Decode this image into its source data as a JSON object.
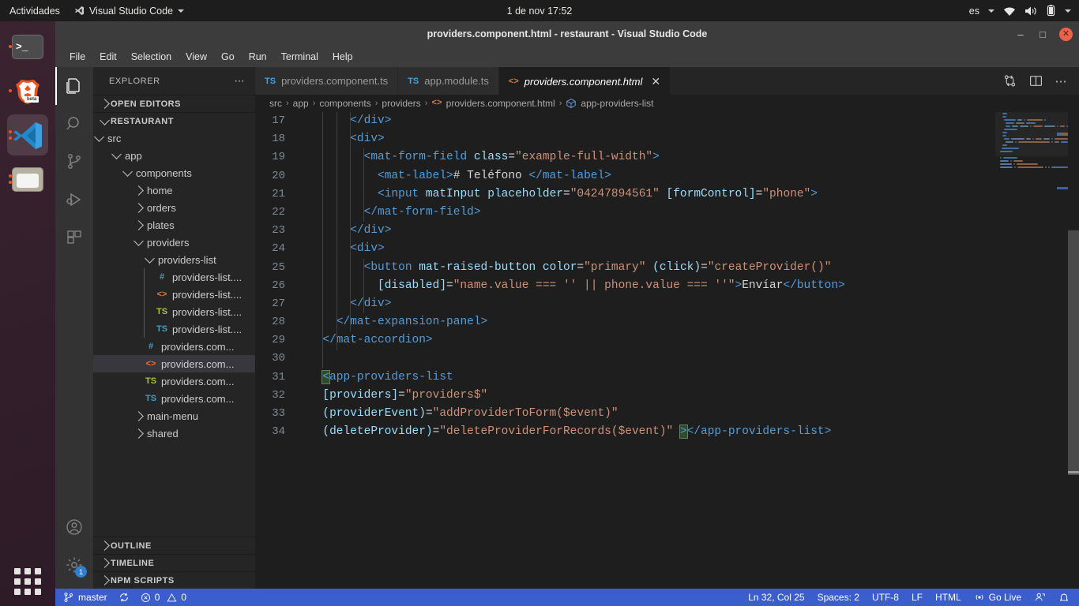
{
  "gnome": {
    "activities": "Actividades",
    "app_menu": "Visual Studio Code",
    "app_icon": "vscode-icon",
    "clock": "1 de nov  17:52",
    "keyboard_layout": "es",
    "icons": [
      "wifi-icon",
      "volume-icon",
      "battery-icon",
      "chevron-down-icon"
    ]
  },
  "dock": {
    "items": [
      {
        "name": "terminal",
        "label": "Terminal",
        "running": true,
        "active": false
      },
      {
        "name": "brave-beta",
        "label": "Brave Beta",
        "badge": "beta",
        "running": true,
        "active": false
      },
      {
        "name": "vscode",
        "label": "Visual Studio Code",
        "running": true,
        "active": true
      },
      {
        "name": "files",
        "label": "Files",
        "running": true,
        "active": false
      }
    ],
    "show_apps_label": "Mostrar aplicaciones"
  },
  "window": {
    "title": "providers.component.html - restaurant - Visual Studio Code",
    "minimize": "–",
    "maximize": "□",
    "close": "✕"
  },
  "menubar": {
    "items": [
      "File",
      "Edit",
      "Selection",
      "View",
      "Go",
      "Run",
      "Terminal",
      "Help"
    ]
  },
  "activitybar": {
    "items": [
      {
        "name": "explorer",
        "icon": "files-icon",
        "active": true
      },
      {
        "name": "search",
        "icon": "search-icon",
        "active": false
      },
      {
        "name": "source-control",
        "icon": "source-control-icon",
        "active": false
      },
      {
        "name": "run-debug",
        "icon": "run-and-debug-icon",
        "active": false
      },
      {
        "name": "extensions",
        "icon": "extensions-icon",
        "active": false
      }
    ],
    "bottom": [
      {
        "name": "accounts",
        "icon": "account-icon",
        "badge": ""
      },
      {
        "name": "manage",
        "icon": "gear-icon",
        "badge": "1"
      }
    ]
  },
  "sidebar": {
    "title": "EXPLORER",
    "more_actions": "⋯",
    "sections": [
      {
        "label": "OPEN EDITORS",
        "expanded": false
      },
      {
        "label": "RESTAURANT",
        "expanded": true
      }
    ],
    "tree": [
      {
        "label": "src",
        "depth": 1,
        "type": "folder",
        "expanded": true
      },
      {
        "label": "app",
        "depth": 2,
        "type": "folder",
        "expanded": true
      },
      {
        "label": "components",
        "depth": 3,
        "type": "folder",
        "expanded": true
      },
      {
        "label": "home",
        "depth": 4,
        "type": "folder",
        "expanded": false
      },
      {
        "label": "orders",
        "depth": 4,
        "type": "folder",
        "expanded": false
      },
      {
        "label": "plates",
        "depth": 4,
        "type": "folder",
        "expanded": false
      },
      {
        "label": "providers",
        "depth": 4,
        "type": "folder",
        "expanded": true
      },
      {
        "label": "providers-list",
        "depth": 5,
        "type": "folder",
        "expanded": true
      },
      {
        "label": "providers-list....",
        "depth": 6,
        "type": "file",
        "icon": "css-icon"
      },
      {
        "label": "providers-list....",
        "depth": 6,
        "type": "file",
        "icon": "html-icon"
      },
      {
        "label": "providers-list....",
        "depth": 6,
        "type": "file",
        "icon": "ts-spec-icon"
      },
      {
        "label": "providers-list....",
        "depth": 6,
        "type": "file",
        "icon": "ts-icon"
      },
      {
        "label": "providers.com...",
        "depth": 5,
        "type": "file",
        "icon": "css-icon"
      },
      {
        "label": "providers.com...",
        "depth": 5,
        "type": "file",
        "icon": "html-icon",
        "selected": true
      },
      {
        "label": "providers.com...",
        "depth": 5,
        "type": "file",
        "icon": "ts-spec-icon"
      },
      {
        "label": "providers.com...",
        "depth": 5,
        "type": "file",
        "icon": "ts-icon"
      },
      {
        "label": "main-menu",
        "depth": 4,
        "type": "folder",
        "expanded": false
      },
      {
        "label": "shared",
        "depth": 4,
        "type": "folder",
        "expanded": false
      }
    ],
    "bottom_sections": [
      {
        "label": "OUTLINE",
        "expanded": false
      },
      {
        "label": "TIMELINE",
        "expanded": false
      },
      {
        "label": "NPM SCRIPTS",
        "expanded": false
      }
    ]
  },
  "tabs": {
    "items": [
      {
        "label": "providers.component.ts",
        "icon": "TS",
        "icon_color": "#4f9fd8",
        "active": false,
        "closable": false
      },
      {
        "label": "app.module.ts",
        "icon": "TS",
        "icon_color": "#4f9fd8",
        "active": false,
        "closable": false
      },
      {
        "label": "providers.component.html",
        "icon": "<>",
        "icon_color": "#e37933",
        "active": true,
        "closable": true
      }
    ],
    "actions": [
      "split-editor-icon",
      "more-actions-icon",
      "source-control-diff-icon"
    ]
  },
  "breadcrumb": {
    "items": [
      {
        "label": "src",
        "icon": ""
      },
      {
        "label": "app",
        "icon": ""
      },
      {
        "label": "components",
        "icon": ""
      },
      {
        "label": "providers",
        "icon": ""
      },
      {
        "label": "providers.component.html",
        "icon": "html-icon"
      },
      {
        "label": "app-providers-list",
        "icon": "symbol-field-icon"
      }
    ],
    "separator": "›"
  },
  "editor": {
    "first_line_number": 17,
    "lines": [
      {
        "n": 17,
        "tokens": [
          {
            "t": "      ",
            "c": "t-txt"
          },
          {
            "t": "</div>",
            "c": "t-tag"
          }
        ]
      },
      {
        "n": 18,
        "tokens": [
          {
            "t": "      ",
            "c": "t-txt"
          },
          {
            "t": "<div>",
            "c": "t-tag"
          }
        ]
      },
      {
        "n": 19,
        "tokens": [
          {
            "t": "        ",
            "c": "t-txt"
          },
          {
            "t": "<mat-form-field",
            "c": "t-tag"
          },
          {
            "t": " class",
            "c": "t-attr"
          },
          {
            "t": "=",
            "c": "t-eq"
          },
          {
            "t": "\"example-full-width\"",
            "c": "t-str"
          },
          {
            "t": ">",
            "c": "t-tag"
          }
        ]
      },
      {
        "n": 20,
        "tokens": [
          {
            "t": "          ",
            "c": "t-txt"
          },
          {
            "t": "<mat-label>",
            "c": "t-tag"
          },
          {
            "t": "# Teléfono ",
            "c": "t-txt"
          },
          {
            "t": "</mat-label>",
            "c": "t-tag"
          }
        ]
      },
      {
        "n": 21,
        "tokens": [
          {
            "t": "          ",
            "c": "t-txt"
          },
          {
            "t": "<input",
            "c": "t-tag"
          },
          {
            "t": " matInput",
            "c": "t-attr"
          },
          {
            "t": " placeholder",
            "c": "t-attr"
          },
          {
            "t": "=",
            "c": "t-eq"
          },
          {
            "t": "\"04247894561\"",
            "c": "t-str"
          },
          {
            "t": " [formControl]",
            "c": "t-attr"
          },
          {
            "t": "=",
            "c": "t-eq"
          },
          {
            "t": "\"phone\"",
            "c": "t-str"
          },
          {
            "t": ">",
            "c": "t-tag"
          }
        ]
      },
      {
        "n": 22,
        "tokens": [
          {
            "t": "        ",
            "c": "t-txt"
          },
          {
            "t": "</mat-form-field>",
            "c": "t-tag"
          }
        ]
      },
      {
        "n": 23,
        "tokens": [
          {
            "t": "      ",
            "c": "t-txt"
          },
          {
            "t": "</div>",
            "c": "t-tag"
          }
        ]
      },
      {
        "n": 24,
        "tokens": [
          {
            "t": "      ",
            "c": "t-txt"
          },
          {
            "t": "<div>",
            "c": "t-tag"
          }
        ]
      },
      {
        "n": 25,
        "tokens": [
          {
            "t": "        ",
            "c": "t-txt"
          },
          {
            "t": "<button",
            "c": "t-tag"
          },
          {
            "t": " mat-raised-button",
            "c": "t-attr"
          },
          {
            "t": " color",
            "c": "t-attr"
          },
          {
            "t": "=",
            "c": "t-eq"
          },
          {
            "t": "\"primary\"",
            "c": "t-str"
          },
          {
            "t": " (click)",
            "c": "t-attr"
          },
          {
            "t": "=",
            "c": "t-eq"
          },
          {
            "t": "\"createProvider()\"",
            "c": "t-str"
          }
        ]
      },
      {
        "n": 26,
        "tokens": [
          {
            "t": "          ",
            "c": "t-txt"
          },
          {
            "t": "[disabled]",
            "c": "t-attr"
          },
          {
            "t": "=",
            "c": "t-eq"
          },
          {
            "t": "\"name.value === '' || phone.value === ''\"",
            "c": "t-str"
          },
          {
            "t": ">",
            "c": "t-tag"
          },
          {
            "t": "Envíar",
            "c": "t-txt"
          },
          {
            "t": "</button>",
            "c": "t-tag"
          }
        ]
      },
      {
        "n": 27,
        "tokens": [
          {
            "t": "      ",
            "c": "t-txt"
          },
          {
            "t": "</div>",
            "c": "t-tag"
          }
        ]
      },
      {
        "n": 28,
        "tokens": [
          {
            "t": "    ",
            "c": "t-txt"
          },
          {
            "t": "</mat-expansion-panel>",
            "c": "t-tag"
          }
        ]
      },
      {
        "n": 29,
        "tokens": [
          {
            "t": "  ",
            "c": "t-txt"
          },
          {
            "t": "</mat-accordion>",
            "c": "t-tag"
          }
        ]
      },
      {
        "n": 30,
        "tokens": []
      },
      {
        "n": 31,
        "tokens": [
          {
            "t": "  ",
            "c": "t-txt"
          },
          {
            "t": "<",
            "c": "t-tag bmatch"
          },
          {
            "t": "app-providers-list",
            "c": "t-tag"
          }
        ]
      },
      {
        "n": 32,
        "tokens": [
          {
            "t": "  ",
            "c": "t-txt"
          },
          {
            "t": "[providers]",
            "c": "t-attr"
          },
          {
            "t": "=",
            "c": "t-eq"
          },
          {
            "t": "\"providers$\"",
            "c": "t-str"
          }
        ]
      },
      {
        "n": 33,
        "tokens": [
          {
            "t": "  ",
            "c": "t-txt"
          },
          {
            "t": "(providerEvent)",
            "c": "t-attr"
          },
          {
            "t": "=",
            "c": "t-eq"
          },
          {
            "t": "\"addProviderToForm($event)\"",
            "c": "t-str"
          }
        ]
      },
      {
        "n": 34,
        "tokens": [
          {
            "t": "  ",
            "c": "t-txt"
          },
          {
            "t": "(deleteProvider)",
            "c": "t-attr"
          },
          {
            "t": "=",
            "c": "t-eq"
          },
          {
            "t": "\"deleteProviderForRecords($event)\"",
            "c": "t-str"
          },
          {
            "t": " ",
            "c": "t-txt"
          },
          {
            "t": ">",
            "c": "t-tag bmatch"
          },
          {
            "t": "</app-providers-list>",
            "c": "t-tag"
          }
        ]
      }
    ]
  },
  "statusbar": {
    "branch": "master",
    "sync_icon": "sync-icon",
    "errors": "0",
    "warnings": "0",
    "position": "Ln 32, Col 25",
    "spaces": "Spaces: 2",
    "encoding": "UTF-8",
    "eol": "LF",
    "language": "HTML",
    "golive": "Go Live",
    "extras": [
      "remote-icon",
      "bell-icon"
    ]
  },
  "colors": {
    "accent_blue": "#3a5fcd",
    "editor_bg": "#1e1e1e",
    "sidebar_bg": "#252526",
    "activitybar_bg": "#333333",
    "titlebar_bg": "#3c3c3c",
    "tag_blue": "#569cd6",
    "attr_blue": "#9cdcfe",
    "string_orange": "#ce9178",
    "text_white": "#d4d4d4",
    "dock_orange": "#e95420"
  }
}
